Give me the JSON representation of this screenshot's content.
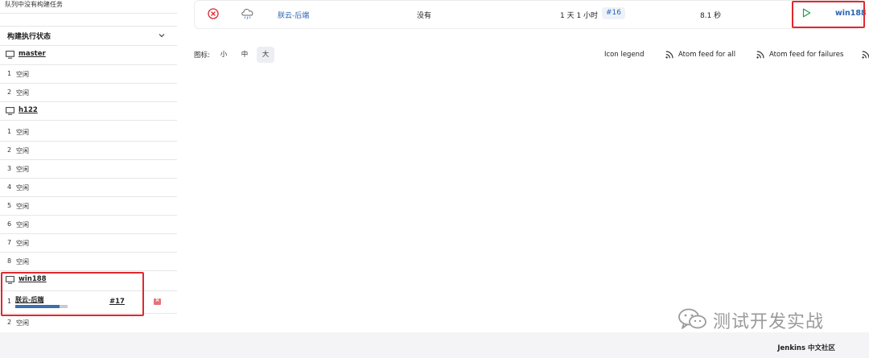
{
  "sidebar": {
    "queue_message": "队列中没有构建任务",
    "executors_title": "构建执行状态",
    "nodes": [
      {
        "name": "master",
        "slots": [
          {
            "num": "1",
            "status": "空闲"
          },
          {
            "num": "2",
            "status": "空闲"
          }
        ]
      },
      {
        "name": "h122",
        "slots": [
          {
            "num": "1",
            "status": "空闲"
          },
          {
            "num": "2",
            "status": "空闲"
          },
          {
            "num": "3",
            "status": "空闲"
          },
          {
            "num": "4",
            "status": "空闲"
          },
          {
            "num": "5",
            "status": "空闲"
          },
          {
            "num": "6",
            "status": "空闲"
          },
          {
            "num": "7",
            "status": "空闲"
          },
          {
            "num": "8",
            "status": "空闲"
          }
        ]
      },
      {
        "name": "win188",
        "slots": [
          {
            "num": "1",
            "job": "朕云-后端",
            "build": "#17",
            "progress": 0.85
          },
          {
            "num": "2",
            "status": "空闲"
          }
        ]
      }
    ],
    "stop_glyph": "×"
  },
  "job": {
    "name": "朕云-后端",
    "last_success": "没有",
    "last_failure": "1 天 1 小时",
    "build": "#16",
    "duration": "8.1 秒",
    "agent": "win188",
    "status_icon": "failed-x-icon",
    "weather_icon": "storm-cloud-icon"
  },
  "toolbar": {
    "icon_label": "图标:",
    "sizes": [
      "小",
      "中",
      "大"
    ],
    "active_size": "大",
    "icon_legend": "Icon legend",
    "feed_all": "Atom feed for all",
    "feed_failures": "Atom feed for failures"
  },
  "footer": {
    "brand": "Jenkins 中文社区"
  },
  "watermark": {
    "text": "测试开发实战"
  },
  "colors": {
    "link": "#2b63b5",
    "highlight": "#e0282e",
    "failed": "#d8262e",
    "play": "#2a9d4a"
  }
}
